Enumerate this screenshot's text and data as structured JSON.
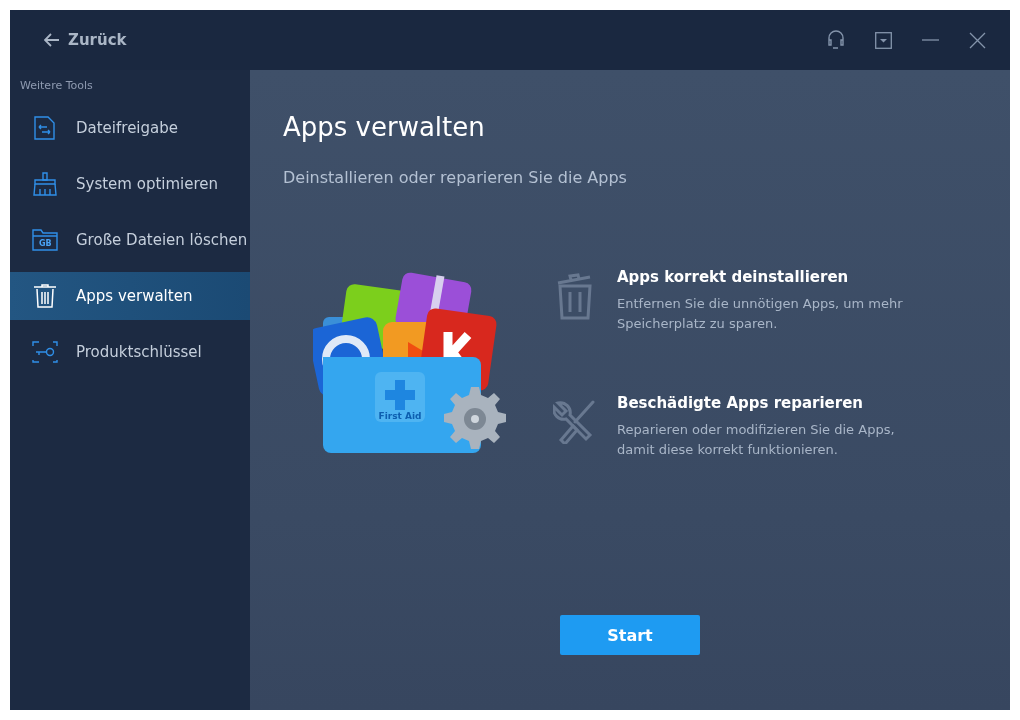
{
  "titlebar": {
    "back_label": "Zurück"
  },
  "sidebar": {
    "heading": "Weitere Tools",
    "items": [
      {
        "label": "Dateifreigabe",
        "kind": "share",
        "selected": false
      },
      {
        "label": "System optimieren",
        "kind": "broom",
        "selected": false
      },
      {
        "label": "Große Dateien löschen",
        "kind": "folder",
        "icon_text": "GB",
        "selected": false
      },
      {
        "label": "Apps verwalten",
        "kind": "trash",
        "selected": true
      },
      {
        "label": "Produktschlüssel",
        "kind": "key",
        "selected": false
      }
    ]
  },
  "main": {
    "title": "Apps verwalten",
    "subtitle": "Deinstallieren oder reparieren Sie die Apps",
    "illustration": {
      "label": "First Aid"
    },
    "features": [
      {
        "kind": "uninstall",
        "title": "Apps korrekt deinstallieren",
        "description": "Entfernen Sie die unnötigen Apps, um mehr Speicherplatz zu sparen."
      },
      {
        "kind": "repair",
        "title": "Beschädigte Apps reparieren",
        "description": "Reparieren oder modifizieren Sie die Apps, damit diese korrekt funktionieren."
      }
    ],
    "start_button": "Start"
  }
}
